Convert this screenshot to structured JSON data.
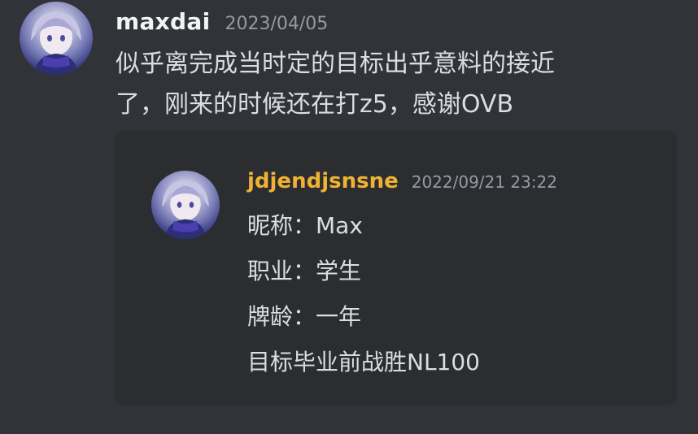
{
  "message": {
    "author": "maxdai",
    "timestamp": "2023/04/05",
    "lines": [
      "似乎离完成当时定的目标出乎意料的接近",
      "了，刚来的时候还在打z5，感谢OVB"
    ]
  },
  "quoted": {
    "author": "jdjendjsnsne",
    "timestamp": "2022/09/21 23:22",
    "lines": [
      "昵称：Max",
      "职业：学生",
      "牌龄：一年",
      "目标毕业前战胜NL100"
    ]
  },
  "colors": {
    "background": "#313338",
    "embed_background": "#2b2d31",
    "author_name": "#f2f3f5",
    "quoted_author_name": "#f0b232",
    "timestamp": "#949ba4",
    "text": "#dbdee1"
  },
  "icons": {
    "main_avatar": "anime-avatar",
    "quoted_avatar": "anime-avatar"
  }
}
